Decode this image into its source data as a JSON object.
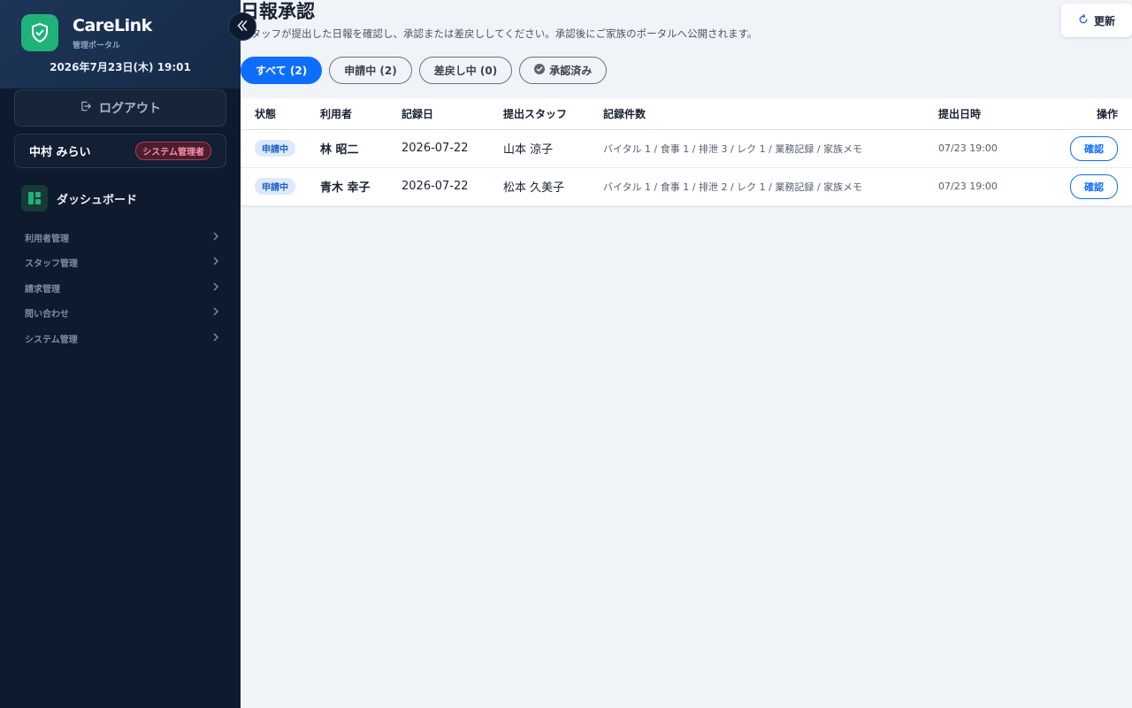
{
  "sidebar": {
    "app_name": "CareLink",
    "app_sub": "管理ポータル",
    "datetime": "2026年7月23日(木) 19:01",
    "logout_label": "ログアウト",
    "user_name": "中村 みらい",
    "role_badge": "システム管理者",
    "dashboard_label": "ダッシュボード",
    "nav_items": [
      {
        "label": "利用者管理"
      },
      {
        "label": "スタッフ管理"
      },
      {
        "label": "請求管理"
      },
      {
        "label": "問い合わせ"
      },
      {
        "label": "システム管理"
      }
    ],
    "accent_color": "#1fb37a"
  },
  "header": {
    "title": "日報承認",
    "description": "スタッフが提出した日報を確認し、承認または差戻ししてください。承認後にご家族のポータルへ公開されます。",
    "refresh_label": "更新"
  },
  "filters": [
    {
      "label": "すべて (2)",
      "active": true
    },
    {
      "label": "申請中 (2)",
      "active": false
    },
    {
      "label": "差戻し中 (0)",
      "active": false
    },
    {
      "label": "承認済み",
      "active": false,
      "icon": "check-circle-icon"
    }
  ],
  "table": {
    "columns": [
      "状態",
      "利用者",
      "記録日",
      "提出スタッフ",
      "記録件数",
      "提出日時",
      "操作"
    ],
    "rows": [
      {
        "status": "申請中",
        "user": "林 昭二",
        "date": "2026-07-22",
        "staff": "山本 涼子",
        "counts": "バイタル 1 / 食事 1 / 排泄 3 / レク 1 / 業務記録 / 家族メモ",
        "submitted": "07/23 19:00",
        "action": "確認"
      },
      {
        "status": "申請中",
        "user": "青木 幸子",
        "date": "2026-07-22",
        "staff": "松本 久美子",
        "counts": "バイタル 1 / 食事 1 / 排泄 2 / レク 1 / 業務記録 / 家族メモ",
        "submitted": "07/23 19:00",
        "action": "確認"
      }
    ]
  },
  "colors": {
    "primary": "#0d6efd",
    "sidebar_bg": "#0e1a2e",
    "role_badge": "#ff8fa8"
  }
}
